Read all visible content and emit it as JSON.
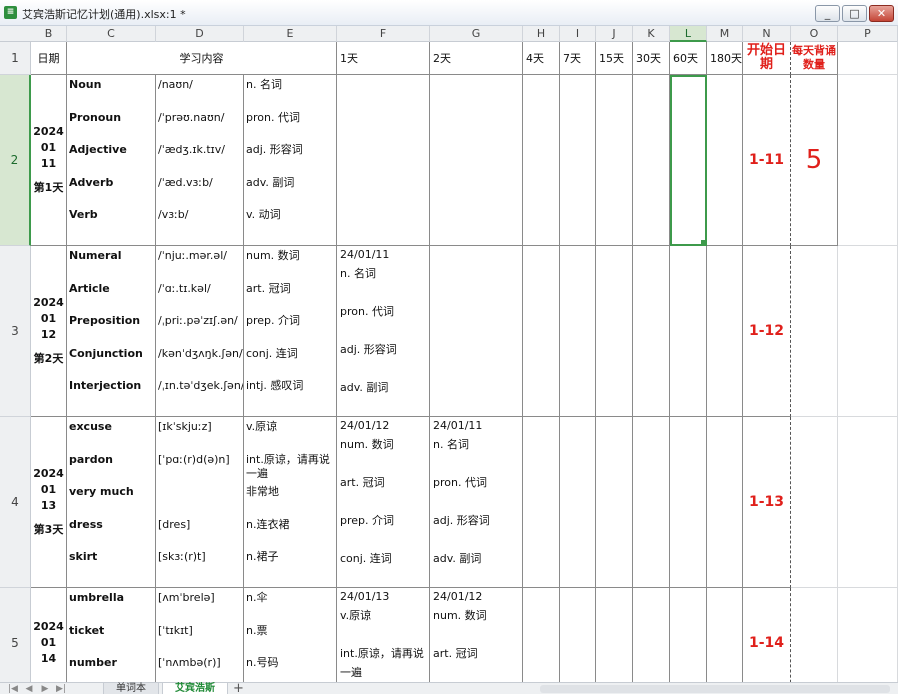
{
  "window": {
    "title": "艾宾浩斯记忆计划(通用).xlsx:1 *",
    "app_icon": "spreadsheet-icon"
  },
  "columns": [
    "B",
    "C",
    "D",
    "E",
    "F",
    "G",
    "H",
    "I",
    "J",
    "K",
    "L",
    "M",
    "N",
    "O",
    "P"
  ],
  "selected_column": "L",
  "rows": [
    "1",
    "2",
    "3",
    "4",
    "5"
  ],
  "selected_row": "2",
  "header": {
    "date": "日期",
    "content": "学习内容",
    "d1": "1天",
    "d2": "2天",
    "d4": "4天",
    "d7": "7天",
    "d15": "15天",
    "d30": "30天",
    "d60": "60天",
    "d180": "180天",
    "start_date": "开始日期",
    "daily_count": "每天背诵数量"
  },
  "days": [
    {
      "year": "2024",
      "month": "01",
      "day": "11",
      "label": "第1天",
      "words": [
        "Noun",
        "Pronoun",
        "Adjective",
        "Adverb",
        "Verb"
      ],
      "phonetics": [
        "/naʊn/",
        "/ˈprəʊ.naʊn/",
        "/ˈædʒ.ɪk.tɪv/",
        "/ˈæd.vɜːb/",
        "/vɜːb/"
      ],
      "meanings": [
        "n. 名词",
        "pron. 代词",
        "adj. 形容词",
        "adv. 副词",
        "v. 动词"
      ],
      "review1": [],
      "review2": [],
      "start": "1-11"
    },
    {
      "year": "2024",
      "month": "01",
      "day": "12",
      "label": "第2天",
      "words": [
        "Numeral",
        "Article",
        "Preposition",
        "Conjunction",
        "Interjection"
      ],
      "phonetics": [
        "/ˈnjuː.mər.əl/",
        "/ˈɑː.tɪ.kəl/",
        "/ˌpriː.pəˈzɪʃ.ən/",
        "/kənˈdʒʌŋk.ʃən/",
        "/ˌɪn.təˈdʒek.ʃən/"
      ],
      "meanings": [
        "num. 数词",
        "art. 冠词",
        "prep. 介词",
        "conj. 连词",
        "intj. 感叹词"
      ],
      "review1": [
        "24/01/11",
        "n. 名词",
        "",
        "pron. 代词",
        "",
        "adj. 形容词",
        "",
        "adv. 副词"
      ],
      "review2": [],
      "start": "1-12"
    },
    {
      "year": "2024",
      "month": "01",
      "day": "13",
      "label": "第3天",
      "words": [
        "excuse",
        "pardon",
        "very much",
        "dress",
        "skirt"
      ],
      "phonetics": [
        "[ɪkˈskjuːz]",
        "[ˈpɑː(r)d(ə)n]",
        "",
        "[dres]",
        "[skɜː(r)t]"
      ],
      "meanings": [
        "v.原谅",
        "int.原谅，请再说一遍",
        "非常地",
        "n.连衣裙",
        "n.裙子"
      ],
      "review1": [
        "24/01/12",
        "num. 数词",
        "",
        "art. 冠词",
        "",
        "prep. 介词",
        "",
        "conj. 连词"
      ],
      "review2": [
        "24/01/11",
        "n. 名词",
        "",
        "pron. 代词",
        "",
        "adj. 形容词",
        "",
        "adv. 副词"
      ],
      "start": "1-13"
    },
    {
      "year": "2024",
      "month": "01",
      "day": "14",
      "label": "",
      "words": [
        "umbrella",
        "ticket",
        "number"
      ],
      "phonetics": [
        "[ʌmˈbrelə]",
        "[ˈtɪkɪt]",
        "[ˈnʌmbə(r)]"
      ],
      "meanings": [
        "n.伞",
        "n.票",
        "n.号码"
      ],
      "review1": [
        "24/01/13",
        "v.原谅",
        "",
        "int.原谅，请再说",
        "一遍"
      ],
      "review2": [
        "24/01/12",
        "num. 数词",
        "",
        "art. 冠词"
      ],
      "start": "1-14"
    }
  ],
  "daily_count_value": "5",
  "sheet_tabs": [
    "单词本",
    "艾宾浩斯"
  ],
  "active_tab": "艾宾浩斯",
  "add_tab": "+"
}
